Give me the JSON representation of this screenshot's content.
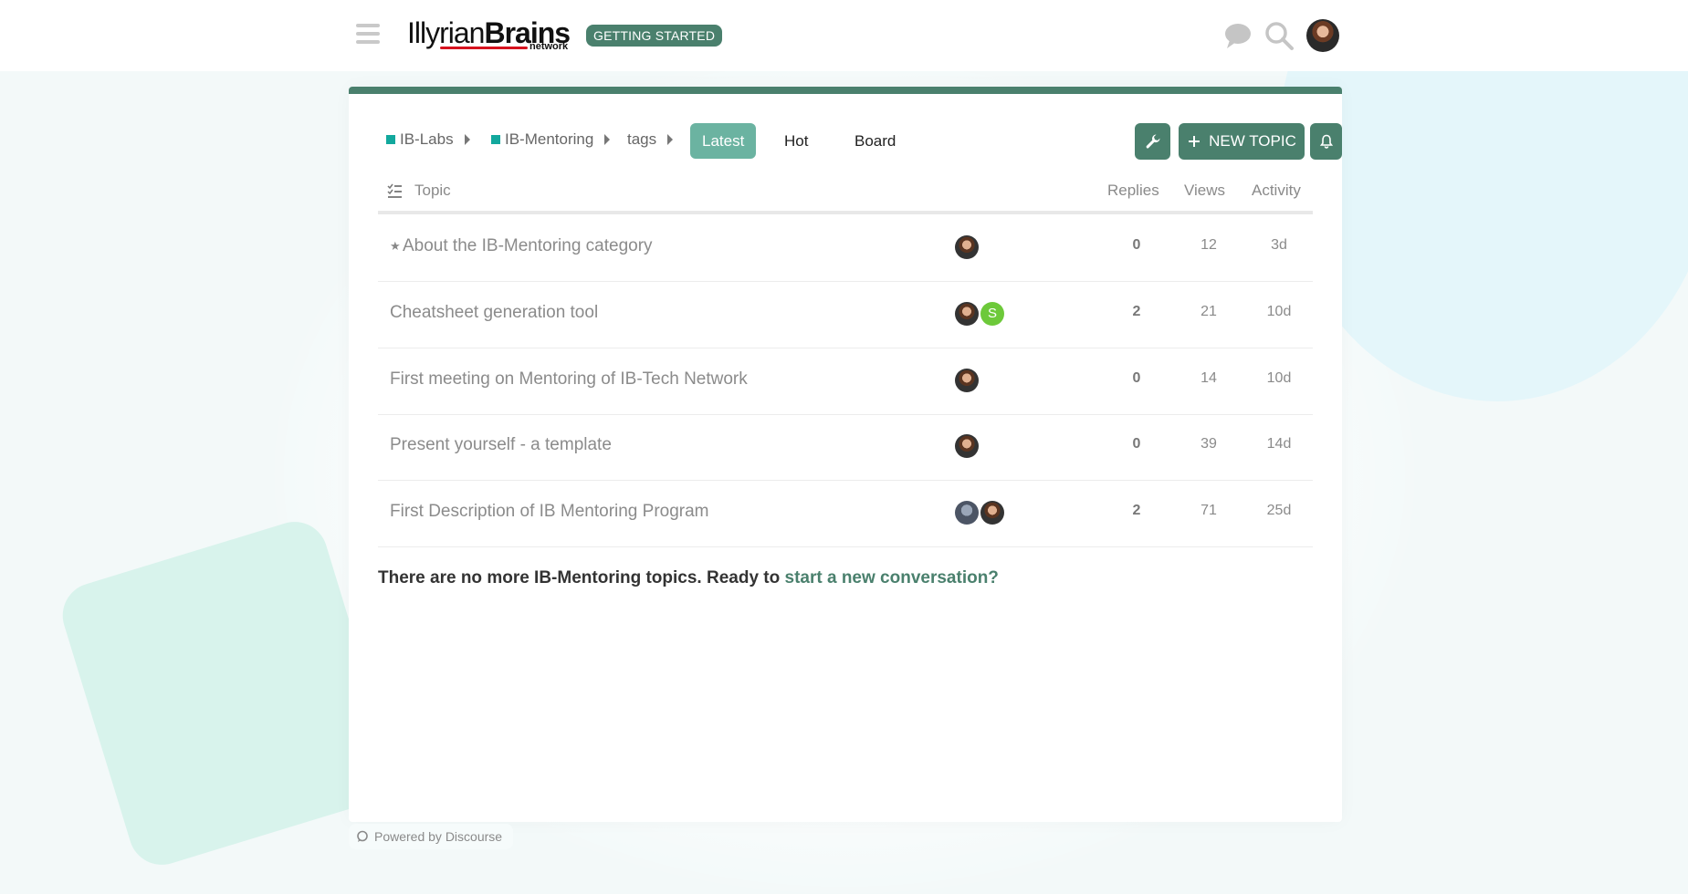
{
  "header": {
    "logo_light": "Illyrian",
    "logo_bold": "Brains",
    "logo_sub": "network",
    "badge": "GETTING STARTED",
    "icons": [
      "hamburger-menu-icon",
      "chat-icon",
      "search-icon",
      "user-avatar"
    ]
  },
  "nav": {
    "crumbs": [
      "IB-Labs",
      "IB-Mentoring",
      "tags"
    ],
    "tabs": [
      "Latest",
      "Hot",
      "Board"
    ],
    "active_tab": "Latest",
    "new_topic_label": "NEW TOPIC"
  },
  "table": {
    "headers": {
      "topic": "Topic",
      "replies": "Replies",
      "views": "Views",
      "activity": "Activity"
    },
    "rows": [
      {
        "title": "About the IB-Mentoring category",
        "pinned": true,
        "replies": "0",
        "views": "12",
        "activity": "3d"
      },
      {
        "title": "Cheatsheet generation tool",
        "pinned": false,
        "replies": "2",
        "views": "21",
        "activity": "10d"
      },
      {
        "title": "First meeting on Mentoring of IB-Tech Network",
        "pinned": false,
        "replies": "0",
        "views": "14",
        "activity": "10d"
      },
      {
        "title": "Present yourself - a template",
        "pinned": false,
        "replies": "0",
        "views": "39",
        "activity": "14d"
      },
      {
        "title": "First Description of IB Mentoring Program",
        "pinned": false,
        "replies": "2",
        "views": "71",
        "activity": "25d"
      }
    ]
  },
  "footer": {
    "message": "There are no more IB-Mentoring topics. Ready to ",
    "link": "start a new conversation?",
    "powered": "Powered by Discourse"
  },
  "colors": {
    "accent": "#4a806d",
    "active_tab": "#6bb3a1",
    "category_square": "#12a89d",
    "logo_red": "#d6121e"
  }
}
